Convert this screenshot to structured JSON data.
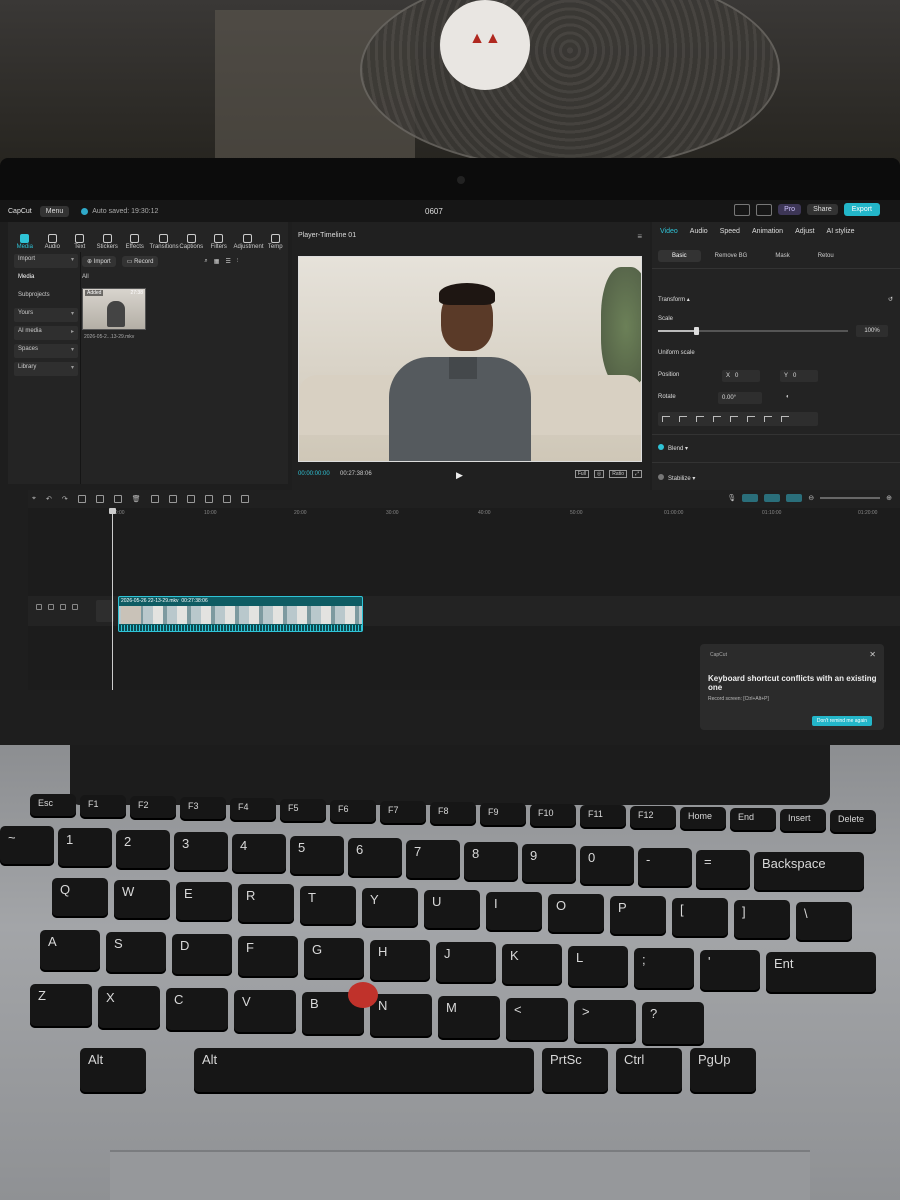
{
  "app": {
    "logo": "CapCut",
    "menu_label": "Menu",
    "autosave_text": "Auto saved: 19:30:12",
    "project_title": "0607",
    "pro_label": "Pro",
    "share_label": "Share",
    "export_label": "Export"
  },
  "toolbar": {
    "tools": [
      "Media",
      "Audio",
      "Text",
      "Stickers",
      "Effects",
      "Transitions",
      "Captions",
      "Filters",
      "Adjustment",
      "Temp"
    ]
  },
  "sidebar": {
    "import": "Import",
    "media": "Media",
    "subprojects": "Subprojects",
    "yours": "Yours",
    "ai_media": "AI media",
    "spaces": "Spaces",
    "library": "Library"
  },
  "media_panel": {
    "import_btn": "Import",
    "record_btn": "Record",
    "filter_all": "All",
    "clip_tag": "Added",
    "clip_duration": "27:38",
    "clip_name": "2026-05-2...13-29.mkv"
  },
  "player": {
    "title": "Player-Timeline 01",
    "timecode_current": "00:00:00:00",
    "timecode_total": "00:27:38:06",
    "full_label": "Full",
    "ratio_label": "Ratio"
  },
  "inspector": {
    "tabs": [
      "Video",
      "Audio",
      "Speed",
      "Animation",
      "Adjust",
      "AI stylize"
    ],
    "subtabs": [
      "Basic",
      "Remove BG",
      "Mask",
      "Retou"
    ],
    "transform": "Transform",
    "scale_label": "Scale",
    "scale_value": "100%",
    "scale_fraction": 0.2,
    "uniform_scale": "Uniform scale",
    "position_label": "Position",
    "pos_x_label": "X",
    "pos_x": "0",
    "pos_y_label": "Y",
    "pos_y": "0",
    "rotate_label": "Rotate",
    "rotate_value": "0.00°",
    "blend_label": "Blend",
    "stabilize_label": "Stabilize"
  },
  "timeline": {
    "ruler_ticks": [
      "00:00",
      "10:00",
      "20:00",
      "30:00",
      "40:00",
      "50:00",
      "01:00:00",
      "01:10:00",
      "01:20:00"
    ],
    "clip_label": "2026-05-26 22-13-29.mkv",
    "clip_duration": "00:27:38:06"
  },
  "toast": {
    "brand": "CapCut",
    "title": "Keyboard shortcut conflicts with an existing one",
    "message": "Record screen: [Ctrl+Alt+P]",
    "button": "Don't remind me again"
  },
  "keyboard": {
    "row0": [
      "Esc",
      "F1",
      "F2",
      "F3",
      "F4",
      "F5",
      "F6",
      "F7",
      "F8",
      "F9",
      "F10",
      "F11",
      "F12",
      "Home",
      "End",
      "Insert",
      "Delete"
    ],
    "row1": [
      "~",
      "1",
      "2",
      "3",
      "4",
      "5",
      "6",
      "7",
      "8",
      "9",
      "0",
      "-",
      "=",
      "Backspace"
    ],
    "row2": [
      "Q",
      "W",
      "E",
      "R",
      "T",
      "Y",
      "U",
      "I",
      "O",
      "P",
      "[",
      "]",
      "\\"
    ],
    "row3": [
      "A",
      "S",
      "D",
      "F",
      "G",
      "H",
      "J",
      "K",
      "L",
      ";",
      "'",
      "Ent"
    ],
    "row4": [
      "Z",
      "X",
      "C",
      "V",
      "B",
      "N",
      "M",
      "<",
      ">",
      "?"
    ],
    "row5": [
      "Alt",
      "Alt",
      "PrtSc",
      "Ctrl",
      "PgUp"
    ]
  },
  "colors": {
    "accent": "#2fc3d6",
    "export": "#23b6c9",
    "clip": "#0e5c63",
    "trackpoint": "#c0322b"
  }
}
